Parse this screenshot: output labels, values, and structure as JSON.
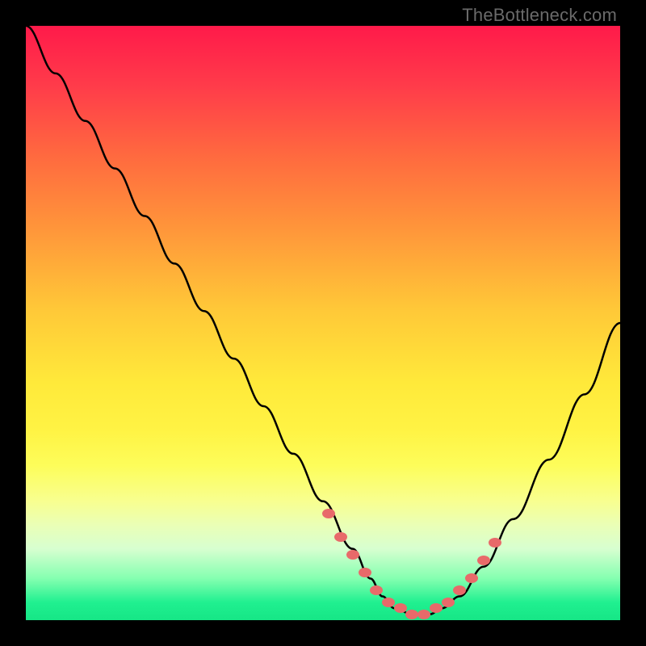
{
  "watermark": "TheBottleneck.com",
  "colors": {
    "background": "#000000",
    "gradient_top": "#ff1a4a",
    "gradient_mid": "#ffe93a",
    "gradient_bottom": "#16e686",
    "curve_stroke": "#000000",
    "marker_fill": "#e86a6a"
  },
  "chart_data": {
    "type": "line",
    "title": "",
    "xlabel": "",
    "ylabel": "",
    "xlim": [
      0,
      100
    ],
    "ylim": [
      0,
      100
    ],
    "grid": false,
    "legend": false,
    "series": [
      {
        "name": "bottleneck-curve",
        "x": [
          0,
          5,
          10,
          15,
          20,
          25,
          30,
          35,
          40,
          45,
          50,
          55,
          58,
          60,
          62,
          65,
          68,
          70,
          73,
          77,
          82,
          88,
          94,
          100
        ],
        "values": [
          100,
          92,
          84,
          76,
          68,
          60,
          52,
          44,
          36,
          28,
          20,
          12,
          7,
          4,
          2,
          1,
          1,
          2,
          4,
          9,
          17,
          27,
          38,
          50
        ]
      }
    ],
    "markers": {
      "name": "highlighted-points",
      "x": [
        51,
        53,
        55,
        57,
        59,
        61,
        63,
        65,
        67,
        69,
        71,
        73,
        75,
        77,
        79
      ],
      "values": [
        18,
        14,
        11,
        8,
        5,
        3,
        2,
        1,
        1,
        2,
        3,
        5,
        7,
        10,
        13
      ]
    }
  }
}
